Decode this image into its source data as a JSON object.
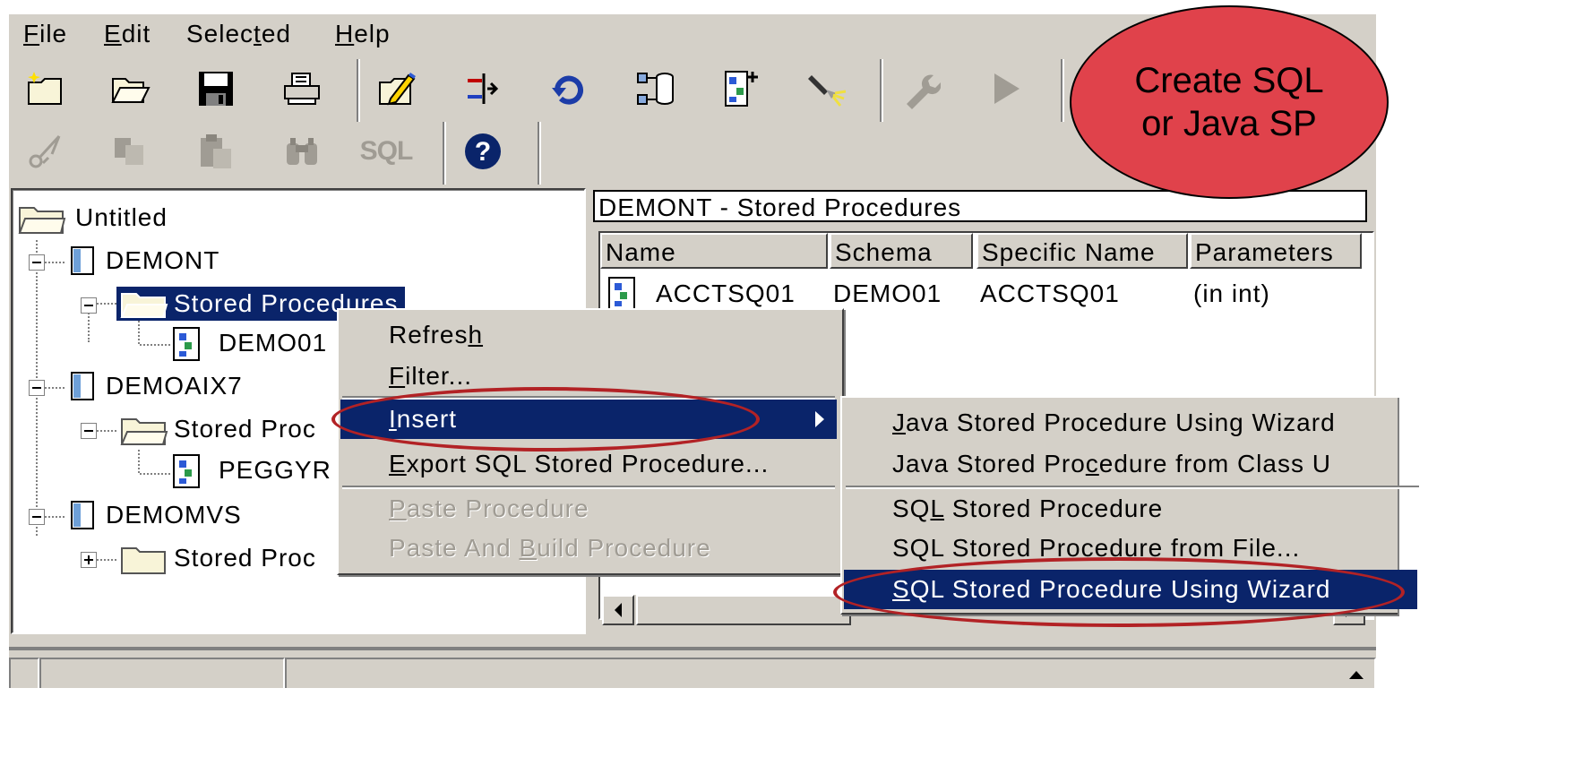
{
  "menubar": {
    "items": [
      {
        "pre": "",
        "u": "F",
        "post": "ile"
      },
      {
        "pre": "",
        "u": "E",
        "post": "dit"
      },
      {
        "pre": "Selec",
        "u": "t",
        "post": "ed"
      },
      {
        "pre": "",
        "u": "H",
        "post": "elp"
      }
    ]
  },
  "toolbar": {
    "sql_label": "SQL",
    "help_glyph": "?"
  },
  "tree": {
    "root": "Untitled",
    "db1": "DEMONT",
    "db1_sp": "Stored Procedures",
    "db1_sp_item": "DEMO01",
    "db2": "DEMOAIX7",
    "db2_sp": "Stored Proc",
    "db2_sp_item": "PEGGYR",
    "db3": "DEMOMVS",
    "db3_sp": "Stored Proc"
  },
  "detail": {
    "title": "DEMONT - Stored Procedures",
    "columns": [
      "Name",
      "Schema",
      "Specific Name",
      "Parameters"
    ],
    "rows": [
      {
        "name": "ACCTSQ01",
        "schema": "DEMO01",
        "specific_name": "ACCTSQ01",
        "parameters": "(in int)"
      }
    ]
  },
  "context_menu": {
    "refresh": {
      "pre": "Refres",
      "u": "h",
      "post": ""
    },
    "filter": {
      "pre": "",
      "u": "F",
      "post": "ilter..."
    },
    "insert": {
      "pre": "",
      "u": "I",
      "post": "nsert"
    },
    "export": {
      "pre": "",
      "u": "E",
      "post": "xport SQL Stored Procedure..."
    },
    "paste": {
      "pre": "",
      "u": "P",
      "post": "aste Procedure"
    },
    "paste_build": {
      "pre": "Paste And ",
      "u": "B",
      "post": "uild Procedure"
    }
  },
  "submenu": {
    "java_wizard": {
      "pre": "",
      "u": "J",
      "post": "ava Stored Procedure Using Wizard"
    },
    "java_class": {
      "pre": "Java Stored Pro",
      "u": "c",
      "post": "edure from Class U"
    },
    "sql_sp": {
      "pre": "SQ",
      "u": "L",
      "post": " Stored Procedure"
    },
    "sql_file": {
      "pre": "SQL Stored Procedure ",
      "u": "f",
      "post": "rom File..."
    },
    "sql_wizard": {
      "pre": "",
      "u": "S",
      "post": "QL Stored Procedure Using Wizard"
    }
  },
  "annotation": {
    "callout": "Create SQL or Java SP"
  },
  "colors": {
    "highlight": "#0a246a",
    "callout_fill": "#e0424b",
    "annotation_ring": "#b22225",
    "window_face": "#d4d0c8"
  }
}
